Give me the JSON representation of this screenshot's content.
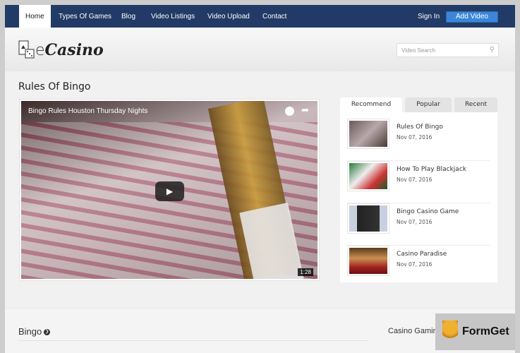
{
  "nav": {
    "items": [
      "Home",
      "Types Of Games",
      "Blog",
      "Video Listings",
      "Video Upload",
      "Contact"
    ],
    "sign_in": "Sign In",
    "add_video": "Add Video"
  },
  "header": {
    "logo_prefix": "e",
    "logo_name": "Casino",
    "search_placeholder": "Video Search"
  },
  "page": {
    "title": "Rules Of Bingo"
  },
  "video": {
    "title": "Bingo Rules Houston Thursday Nights",
    "duration": "1:28"
  },
  "sidebar": {
    "tabs": [
      "Recommend",
      "Popular",
      "Recent"
    ],
    "active_tab": "Recommend",
    "items": [
      {
        "title": "Rules Of Bingo",
        "date": "Nov 07, 2016"
      },
      {
        "title": "How To Play Blackjack",
        "date": "Nov 07, 2016"
      },
      {
        "title": "Bingo Casino Game",
        "date": "Nov 07, 2016"
      },
      {
        "title": "Casino Paradise",
        "date": "Nov 07, 2016"
      }
    ]
  },
  "sections": {
    "bingo": "Bingo",
    "casino_gaming": "Casino Gamin"
  },
  "watermark": {
    "text": "FormGet"
  },
  "colors": {
    "nav": "#213b66",
    "button": "#3b86d8"
  }
}
